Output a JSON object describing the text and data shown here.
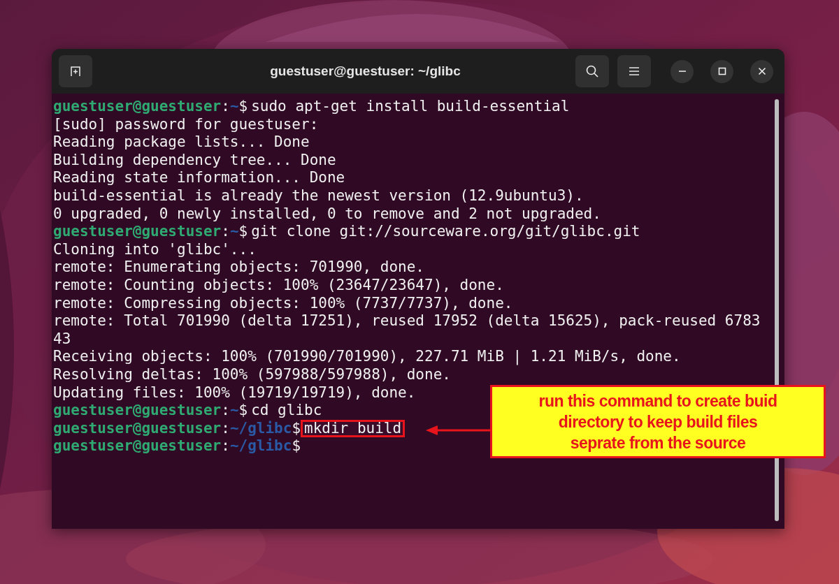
{
  "window": {
    "title": "guestuser@guestuser: ~/glibc"
  },
  "terminal": {
    "lines": [
      {
        "kind": "prompt",
        "user": "guestuser@guestuser",
        "separator": ":",
        "path": "~",
        "symbol": "$",
        "command": "sudo apt-get install build-essential",
        "highlighted": false
      },
      {
        "kind": "output",
        "text": "[sudo] password for guestuser:"
      },
      {
        "kind": "output",
        "text": "Reading package lists... Done"
      },
      {
        "kind": "output",
        "text": "Building dependency tree... Done"
      },
      {
        "kind": "output",
        "text": "Reading state information... Done"
      },
      {
        "kind": "output",
        "text": "build-essential is already the newest version (12.9ubuntu3)."
      },
      {
        "kind": "output",
        "text": "0 upgraded, 0 newly installed, 0 to remove and 2 not upgraded."
      },
      {
        "kind": "prompt",
        "user": "guestuser@guestuser",
        "separator": ":",
        "path": "~",
        "symbol": "$",
        "command": "git clone git://sourceware.org/git/glibc.git",
        "highlighted": false
      },
      {
        "kind": "output",
        "text": "Cloning into 'glibc'..."
      },
      {
        "kind": "output",
        "text": "remote: Enumerating objects: 701990, done."
      },
      {
        "kind": "output",
        "text": "remote: Counting objects: 100% (23647/23647), done."
      },
      {
        "kind": "output",
        "text": "remote: Compressing objects: 100% (7737/7737), done."
      },
      {
        "kind": "output",
        "text": "remote: Total 701990 (delta 17251), reused 17952 (delta 15625), pack-reused 6783"
      },
      {
        "kind": "output",
        "text": "43"
      },
      {
        "kind": "output",
        "text": "Receiving objects: 100% (701990/701990), 227.71 MiB | 1.21 MiB/s, done."
      },
      {
        "kind": "output",
        "text": "Resolving deltas: 100% (597988/597988), done."
      },
      {
        "kind": "output",
        "text": "Updating files: 100% (19719/19719), done."
      },
      {
        "kind": "prompt",
        "user": "guestuser@guestuser",
        "separator": ":",
        "path": "~",
        "symbol": "$",
        "command": "cd glibc",
        "highlighted": false
      },
      {
        "kind": "prompt",
        "user": "guestuser@guestuser",
        "separator": ":",
        "path": "~/glibc",
        "symbol": "$",
        "command": "mkdir build",
        "highlighted": true
      },
      {
        "kind": "prompt",
        "user": "guestuser@guestuser",
        "separator": ":",
        "path": "~/glibc",
        "symbol": "$"
      }
    ]
  },
  "annotation": {
    "lines": [
      "run this command to create buid",
      "directory to keep build files",
      "seprate from the source"
    ]
  }
}
